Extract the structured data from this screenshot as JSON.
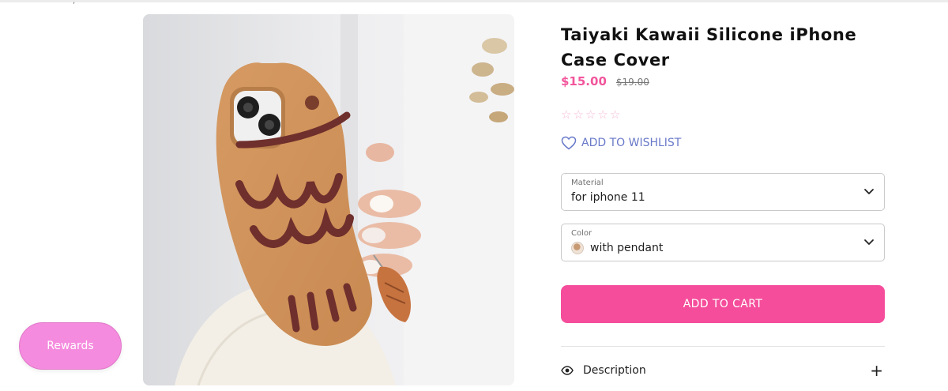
{
  "product": {
    "title": "Taiyaki Kawaii Silicone iPhone Case Cover",
    "price": "$15.00",
    "compare_price": "$19.00",
    "rating_stars": 0,
    "rating_max": 5,
    "wishlist_label": "ADD TO WISHLIST",
    "image_alt": "taiyaki-fish-phone-case-photo"
  },
  "options": {
    "material": {
      "label": "Material",
      "value": "for iphone 11"
    },
    "color": {
      "label": "Color",
      "value": "with pendant"
    }
  },
  "actions": {
    "add_to_cart": "ADD TO CART"
  },
  "accordion": {
    "description_label": "Description",
    "toggle_symbol": "+"
  },
  "widgets": {
    "rewards_label": "Rewards"
  },
  "colors": {
    "price": "#f2559c",
    "cart_button": "#f54d9b",
    "wishlist": "#6979c9",
    "rewards": "#f58bde",
    "stars": "#f7b9d6"
  },
  "icons": {
    "wishlist": "heart-outline-icon",
    "select_chevron": "chevron-down-icon",
    "description": "eye-icon",
    "expand": "plus-icon"
  }
}
